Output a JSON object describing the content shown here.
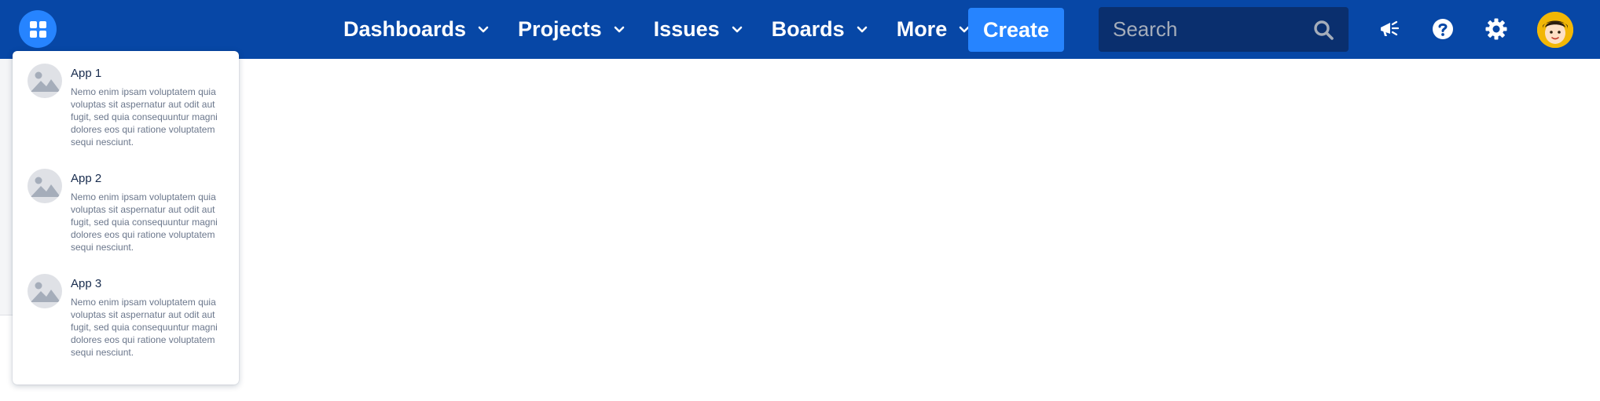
{
  "header": {
    "nav": [
      {
        "label": "Dashboards",
        "icon": "chevron-down-icon"
      },
      {
        "label": "Projects",
        "icon": "chevron-down-icon"
      },
      {
        "label": "Issues",
        "icon": "chevron-down-icon"
      },
      {
        "label": "Boards",
        "icon": "chevron-down-icon"
      },
      {
        "label": "More",
        "icon": "chevron-down-icon"
      }
    ],
    "create_label": "Create",
    "search_placeholder": "Search",
    "icons": [
      "app-switcher-icon",
      "megaphone-icon",
      "help-icon",
      "gear-icon",
      "avatar"
    ]
  },
  "app_menu": {
    "items": [
      {
        "title": "App 1",
        "description": "Nemo enim ipsam voluptatem quia voluptas sit aspernatur aut odit aut fugit, sed quia consequuntur magni dolores eos qui ratione voluptatem sequi nesciunt."
      },
      {
        "title": "App 2",
        "description": "Nemo enim ipsam voluptatem quia voluptas sit aspernatur aut odit aut fugit, sed quia consequuntur magni dolores eos qui ratione voluptatem sequi nesciunt."
      },
      {
        "title": "App 3",
        "description": "Nemo enim ipsam voluptatem quia voluptas sit aspernatur aut odit aut fugit, sed quia consequuntur magni dolores eos qui ratione voluptatem sequi nesciunt."
      }
    ]
  },
  "colors": {
    "topbar": "#0747a6",
    "accent": "#2684ff",
    "search_bg": "#0a2f6e",
    "text_primary": "#172b4d",
    "text_secondary": "#6b778c"
  }
}
